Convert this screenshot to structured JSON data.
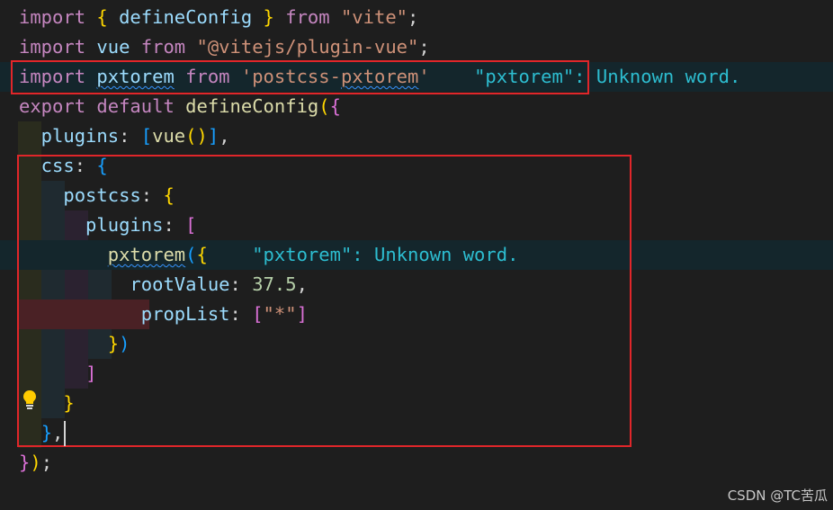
{
  "editor": {
    "diagnostic_message": "\"pxtorem\": Unknown word.",
    "lines": [
      {
        "tokens": [
          {
            "t": "import",
            "c": "kw"
          },
          {
            "t": " ",
            "c": "pl"
          },
          {
            "t": "{",
            "c": "b1"
          },
          {
            "t": " defineConfig ",
            "c": "id"
          },
          {
            "t": "}",
            "c": "b1"
          },
          {
            "t": " ",
            "c": "pl"
          },
          {
            "t": "from",
            "c": "kw"
          },
          {
            "t": " ",
            "c": "pl"
          },
          {
            "t": "\"vite\"",
            "c": "str"
          },
          {
            "t": ";",
            "c": "pl"
          }
        ]
      },
      {
        "tokens": [
          {
            "t": "import",
            "c": "kw"
          },
          {
            "t": " ",
            "c": "pl"
          },
          {
            "t": "vue",
            "c": "id"
          },
          {
            "t": " ",
            "c": "pl"
          },
          {
            "t": "from",
            "c": "kw"
          },
          {
            "t": " ",
            "c": "pl"
          },
          {
            "t": "\"@vitejs/plugin-vue\"",
            "c": "str"
          },
          {
            "t": ";",
            "c": "pl"
          }
        ]
      },
      {
        "highlight": true,
        "tokens": [
          {
            "t": "import",
            "c": "kw"
          },
          {
            "t": " ",
            "c": "pl"
          },
          {
            "t": "pxtorem",
            "c": "id squig"
          },
          {
            "t": " ",
            "c": "pl"
          },
          {
            "t": "from",
            "c": "kw"
          },
          {
            "t": " ",
            "c": "pl"
          },
          {
            "t": "'postcss-",
            "c": "str"
          },
          {
            "t": "pxtorem",
            "c": "str squig"
          },
          {
            "t": "'",
            "c": "str"
          },
          {
            "t": "    ",
            "c": "pl"
          },
          {
            "t": "\"pxtorem\": Unknown word.",
            "c": "lens"
          }
        ]
      },
      {
        "tokens": [
          {
            "t": "export",
            "c": "kw"
          },
          {
            "t": " ",
            "c": "pl"
          },
          {
            "t": "default",
            "c": "kw"
          },
          {
            "t": " ",
            "c": "pl"
          },
          {
            "t": "defineConfig",
            "c": "fn"
          },
          {
            "t": "(",
            "c": "b1"
          },
          {
            "t": "{",
            "c": "b2"
          }
        ]
      },
      {
        "tokens": [
          {
            "t": "  plugins",
            "c": "id"
          },
          {
            "t": ": ",
            "c": "pl"
          },
          {
            "t": "[",
            "c": "b3"
          },
          {
            "t": "vue",
            "c": "fn"
          },
          {
            "t": "()",
            "c": "b1"
          },
          {
            "t": "]",
            "c": "b3"
          },
          {
            "t": ",",
            "c": "pl"
          }
        ]
      },
      {
        "tokens": [
          {
            "t": "  css",
            "c": "id"
          },
          {
            "t": ": ",
            "c": "pl"
          },
          {
            "t": "{",
            "c": "b3"
          }
        ]
      },
      {
        "tokens": [
          {
            "t": "    postcss",
            "c": "id"
          },
          {
            "t": ": ",
            "c": "pl"
          },
          {
            "t": "{",
            "c": "b1"
          }
        ]
      },
      {
        "tokens": [
          {
            "t": "      plugins",
            "c": "id"
          },
          {
            "t": ": ",
            "c": "pl"
          },
          {
            "t": "[",
            "c": "b2"
          }
        ]
      },
      {
        "highlight": true,
        "tokens": [
          {
            "t": "        ",
            "c": "pl"
          },
          {
            "t": "pxtorem",
            "c": "fn squig"
          },
          {
            "t": "(",
            "c": "b3"
          },
          {
            "t": "{",
            "c": "b1"
          },
          {
            "t": "    ",
            "c": "pl"
          },
          {
            "t": "\"pxtorem\": Unknown word.",
            "c": "lens"
          }
        ]
      },
      {
        "tokens": [
          {
            "t": "          rootValue",
            "c": "id"
          },
          {
            "t": ": ",
            "c": "pl"
          },
          {
            "t": "37.5",
            "c": "num"
          },
          {
            "t": ",",
            "c": "pl"
          }
        ]
      },
      {
        "tokens": [
          {
            "t": "           propList",
            "c": "id"
          },
          {
            "t": ": ",
            "c": "pl"
          },
          {
            "t": "[",
            "c": "b2"
          },
          {
            "t": "\"*\"",
            "c": "str"
          },
          {
            "t": "]",
            "c": "b2"
          }
        ]
      },
      {
        "tokens": [
          {
            "t": "        ",
            "c": "pl"
          },
          {
            "t": "}",
            "c": "b1"
          },
          {
            "t": ")",
            "c": "b3"
          }
        ]
      },
      {
        "tokens": [
          {
            "t": "      ",
            "c": "pl"
          },
          {
            "t": "]",
            "c": "b2"
          }
        ]
      },
      {
        "tokens": [
          {
            "t": "    ",
            "c": "pl"
          },
          {
            "t": "}",
            "c": "b1"
          }
        ]
      },
      {
        "tokens": [
          {
            "t": "  ",
            "c": "pl"
          },
          {
            "t": "}",
            "c": "b3"
          },
          {
            "t": ",",
            "c": "pl"
          }
        ]
      },
      {
        "tokens": [
          {
            "t": "}",
            "c": "b2"
          },
          {
            "t": ")",
            "c": "b1"
          },
          {
            "t": ";",
            "c": "pl"
          }
        ]
      }
    ]
  },
  "watermark": "CSDN @TC苦瓜",
  "colors": {
    "background": "#1e1e1e",
    "highlight_row": "#14262c",
    "annotation_box": "#e0262a",
    "squiggle": "#3794ff"
  }
}
